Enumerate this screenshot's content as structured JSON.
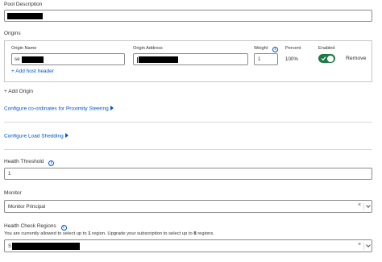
{
  "pool_description": {
    "label": "Pool Description"
  },
  "origins": {
    "title": "Origins",
    "origin_name_label": "Origin Name",
    "origin_name_value": "se",
    "origin_address_label": "Origin Address",
    "origin_address_value": "",
    "weight_label": "Weight",
    "weight_value": "1",
    "percent_label": "Percent",
    "percent_value": "100%",
    "enabled_label": "Enabled",
    "enabled": true,
    "remove_label": "Remove",
    "add_host_header": "+ Add host header",
    "add_origin": "+ Add Origin"
  },
  "proximity_steering": {
    "label": "Configure co-ordinates for Proximity Steering"
  },
  "load_shedding": {
    "label": "Configure Load Shedding"
  },
  "health_threshold": {
    "label": "Health Threshold",
    "value": "1"
  },
  "monitor": {
    "label": "Monitor",
    "value": "Monitor Principal",
    "clear": "×"
  },
  "health_check_regions": {
    "label": "Health Check Regions",
    "note_before": "You are currently allowed to select up to ",
    "note_count1": "1",
    "note_mid": " region. Upgrade your subscription to select up to ",
    "note_count2": "8",
    "note_after": " regions.",
    "value": "S",
    "clear": "×"
  },
  "colors": {
    "link": "#0055cc",
    "toggle_on": "#1d7a44",
    "redaction": "#000000"
  }
}
